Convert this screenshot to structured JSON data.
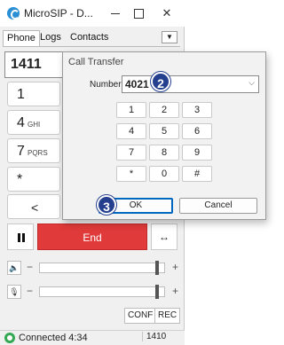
{
  "window": {
    "title": "MicroSIP - D...",
    "tabs": [
      "Phone",
      "Logs",
      "Contacts"
    ],
    "menu_arrow": "▼"
  },
  "dialer": {
    "number": "1411",
    "keys": [
      {
        "num": "1",
        "sub": ""
      },
      {
        "num": "4",
        "sub": "GHI"
      },
      {
        "num": "7",
        "sub": "PQRS"
      },
      {
        "num": "*",
        "sub": ""
      }
    ],
    "back_key": "<"
  },
  "call_controls": {
    "end_label": "End",
    "transfer_glyph": "↔"
  },
  "volume": {
    "speaker_level": 0.95,
    "mic_level": 0.95
  },
  "buttons": {
    "conf": "CONF",
    "rec": "REC"
  },
  "status": {
    "text": "Connected 4:34",
    "extension": "1410",
    "color": "#34a853"
  },
  "transfer_dialog": {
    "title": "Call Transfer",
    "number_label": "Number",
    "number_value": "4021",
    "keypad": [
      "1",
      "2",
      "3",
      "4",
      "5",
      "6",
      "7",
      "8",
      "9",
      "*",
      "0",
      "#"
    ],
    "ok_label": "OK",
    "cancel_label": "Cancel"
  },
  "markers": [
    "2",
    "3"
  ],
  "colors": {
    "end_button": "#e03a3a",
    "ok_focus": "#0067c0",
    "marker": "#233f8e"
  }
}
